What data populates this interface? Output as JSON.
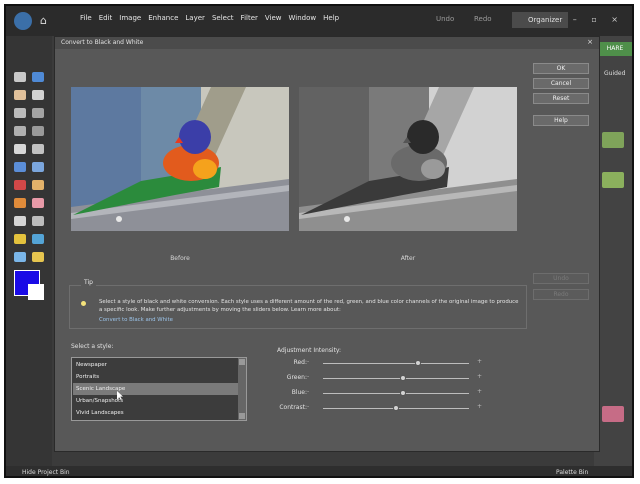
{
  "menubar": {
    "items": [
      "File",
      "Edit",
      "Image",
      "Enhance",
      "Layer",
      "Select",
      "Filter",
      "View",
      "Window",
      "Help"
    ],
    "undo": "Undo",
    "redo": "Redo",
    "organizer": "Organizer",
    "window_controls": "– ▫ ×"
  },
  "right_panel": {
    "share": "HARE",
    "guided": "Guided"
  },
  "status": {
    "left": "Hide Project Bin",
    "right": "Palette Bin"
  },
  "dialog": {
    "title": "Convert to Black and White",
    "close": "×",
    "before_label": "Before",
    "after_label": "After",
    "buttons": {
      "ok": "OK",
      "cancel": "Cancel",
      "reset": "Reset",
      "help": "Help",
      "undo": "Undo",
      "redo": "Redo"
    },
    "tip": {
      "title": "Tip",
      "text": "Select a style of black and white conversion. Each style uses a different amount of the red, green, and blue color channels of the original image to produce a specific look. Make further adjustments by moving the sliders below. Learn more about:",
      "link": "Convert to Black and White"
    },
    "style_label": "Select a style:",
    "styles": [
      "Newspaper",
      "Portraits",
      "Scenic Landscape",
      "Urban/Snapshots",
      "Vivid Landscapes"
    ],
    "selected_style": "Scenic Landscape",
    "adjustment_label": "Adjustment Intensity:",
    "sliders": [
      {
        "label": "Red:",
        "value": 0.65
      },
      {
        "label": "Green:",
        "value": 0.55
      },
      {
        "label": "Blue:",
        "value": 0.55
      },
      {
        "label": "Contrast:",
        "value": 0.5
      }
    ],
    "slider_minus": "-",
    "slider_plus": "+"
  },
  "colors": {
    "foreground": "#1a0be6",
    "background": "#ffffff",
    "accent_green": "#4f8f4a"
  }
}
